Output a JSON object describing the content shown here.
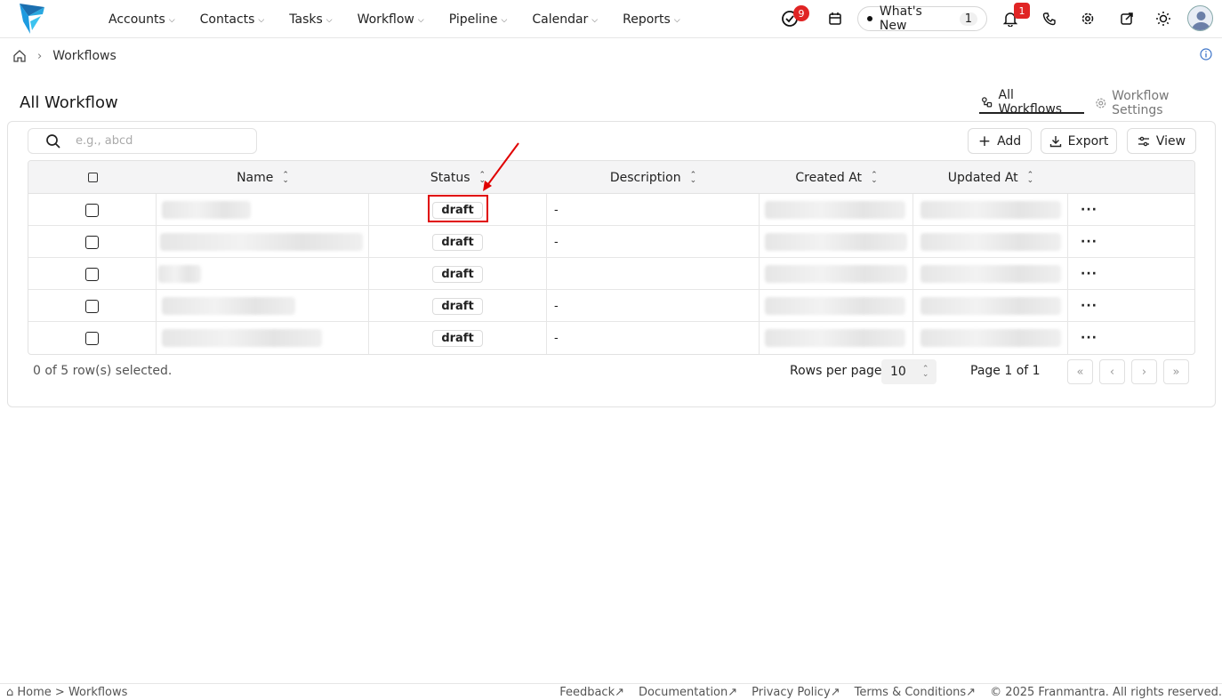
{
  "nav": {
    "items": [
      {
        "label": "Accounts"
      },
      {
        "label": "Contacts"
      },
      {
        "label": "Tasks"
      },
      {
        "label": "Workflow"
      },
      {
        "label": "Pipeline"
      },
      {
        "label": "Calendar"
      },
      {
        "label": "Reports"
      }
    ],
    "tasks_badge": "9",
    "whats_new_label": "What's New",
    "whats_new_count": "1",
    "notif_badge": "1"
  },
  "breadcrumb": {
    "current": "Workflows"
  },
  "page": {
    "title": "All Workflow",
    "tabs": [
      {
        "label": "All Workflows"
      },
      {
        "label": "Workflow Settings"
      }
    ]
  },
  "toolbar": {
    "search_placeholder": "e.g., abcd",
    "add_label": "Add",
    "export_label": "Export",
    "view_label": "View"
  },
  "table": {
    "columns": [
      "Name",
      "Status",
      "Description",
      "Created At",
      "Updated At"
    ],
    "rows": [
      {
        "status": "draft",
        "description": "-"
      },
      {
        "status": "draft",
        "description": "-"
      },
      {
        "status": "draft",
        "description": ""
      },
      {
        "status": "draft",
        "description": "-"
      },
      {
        "status": "draft",
        "description": "-"
      }
    ]
  },
  "pagination": {
    "selected_text": "0 of 5 row(s) selected.",
    "rows_per_page_label": "Rows per page",
    "rows_per_page_value": "10",
    "page_text": "Page 1 of 1"
  },
  "footer": {
    "breadcrumb_home": "⌂ Home >",
    "breadcrumb_current": "Workflows",
    "links": [
      {
        "label": "Feedback"
      },
      {
        "label": "Documentation"
      },
      {
        "label": "Privacy Policy"
      },
      {
        "label": "Terms & Conditions"
      }
    ],
    "copyright": "© 2025 Franmantra. All rights reserved."
  },
  "colors": {
    "brand": "#29a8e0",
    "badge": "#e02424",
    "annotation": "#e00000"
  }
}
